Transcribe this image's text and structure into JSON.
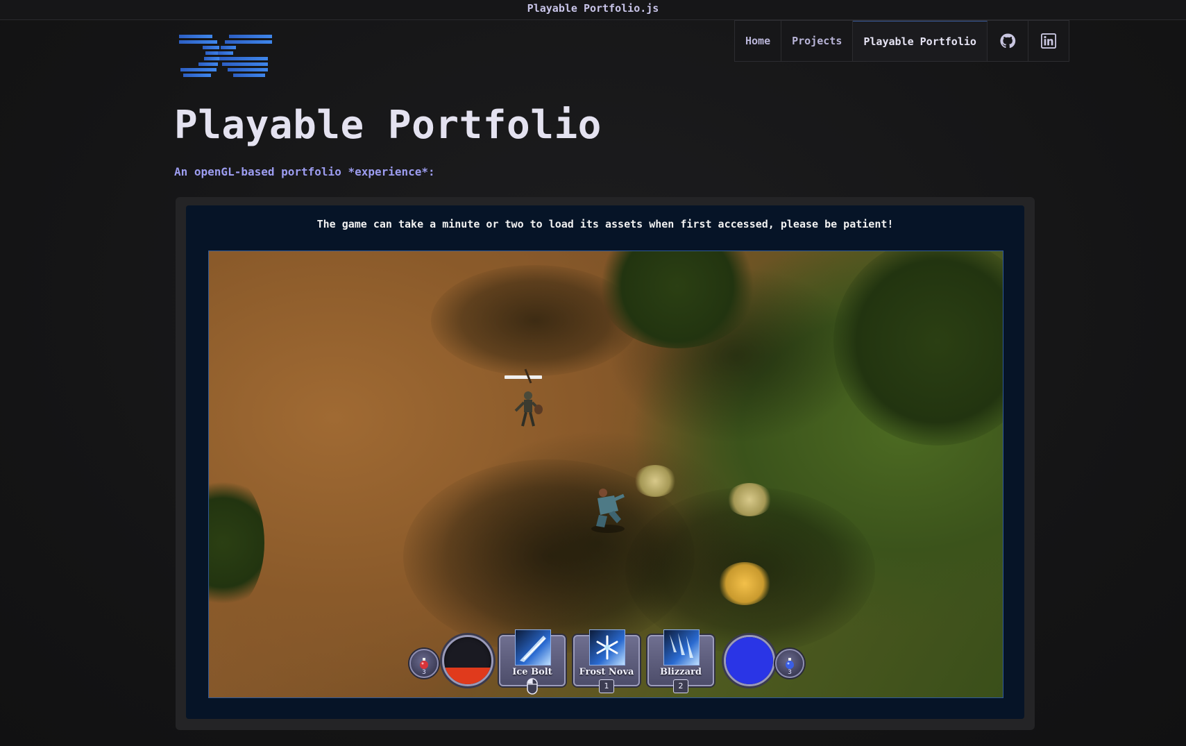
{
  "browser": {
    "tab_title": "Playable Portfolio.js"
  },
  "header": {
    "logo": "DG",
    "nav": [
      {
        "label": "Home"
      },
      {
        "label": "Projects"
      },
      {
        "label": "Playable Portfolio",
        "active": true
      }
    ],
    "icons": [
      "github-icon",
      "linkedin-icon"
    ]
  },
  "page": {
    "title": "Playable Portfolio",
    "subtitle": "An openGL-based portfolio *experience*:",
    "notice": "The game can take a minute or two to load its assets when first accessed, please be patient!"
  },
  "game_hud": {
    "health_potions": "3",
    "mana_potions": "3",
    "health_level": 0.35,
    "mana_level": 1.0,
    "health_color": "#e03a1c",
    "mana_color": "#2a35e6",
    "skills": [
      {
        "label": "Ice Bolt",
        "key": "mouse-left",
        "icon": "ice-bolt-icon"
      },
      {
        "label": "Frost Nova",
        "key": "1",
        "icon": "frost-nova-icon"
      },
      {
        "label": "Blizzard",
        "key": "2",
        "icon": "blizzard-icon"
      }
    ]
  },
  "colors": {
    "background": "#141415",
    "accent": "#9d9df0",
    "frame": "#061427",
    "game_border": "#2f5a9a"
  }
}
